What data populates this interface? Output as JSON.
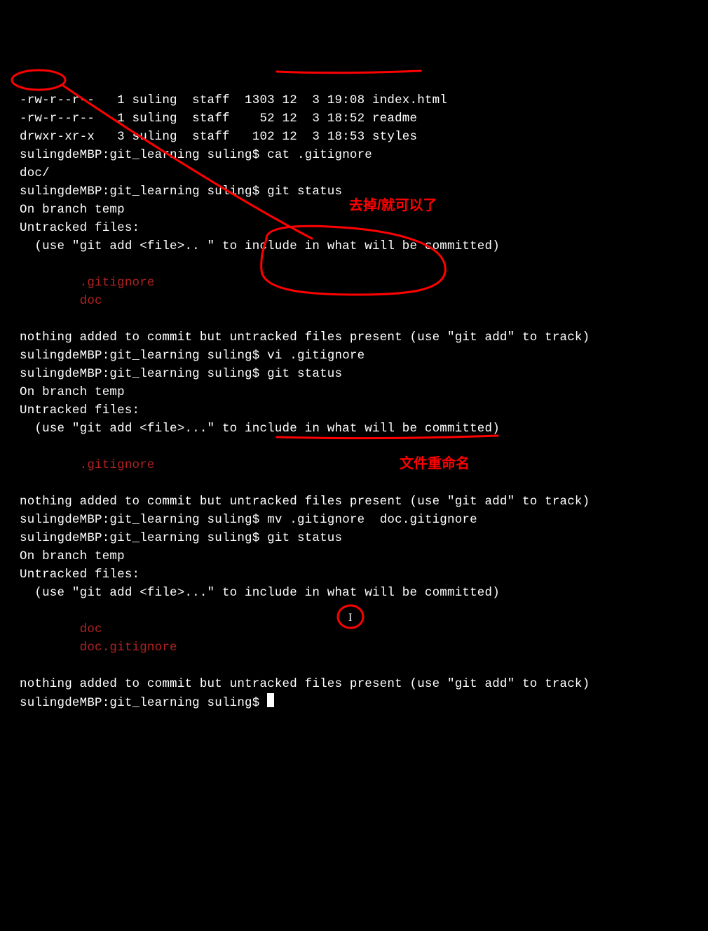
{
  "terminal": {
    "ls": {
      "l1": "-rw-r--r--   1 suling  staff  1303 12  3 19:08 index.html",
      "l2": "-rw-r--r--   1 suling  staff    52 12  3 18:52 readme",
      "l3": "drwxr-xr-x   3 suling  staff   102 12  3 18:53 styles"
    },
    "prompt": "sulingdeMBP:git_learning suling$ ",
    "cmd_cat": "cat .gitignore",
    "cat_out": "doc/",
    "cmd_status1": "git status",
    "status_branch": "On branch temp",
    "status_untracked_hdr": "Untracked files:",
    "status_hint_a": "  (use \"git add <file>.. \" to include in what will be committed)",
    "status_hint_b": "  (use \"git add <file>...\" to include in what will be committed)",
    "untracked_gitignore": "        .gitignore",
    "untracked_doc": "        doc",
    "nothing_added": "nothing added to commit but untracked files present (use \"git add\" to track)",
    "cmd_vi": "vi .gitignore",
    "cmd_status2": "git status",
    "cmd_mv": "mv .gitignore  doc.gitignore",
    "cmd_status3": "git status",
    "untracked_doc2": "        doc",
    "untracked_docgitignore": "        doc.gitignore"
  },
  "annotations": {
    "remove_slash": "去掉/就可以了",
    "rename_file": "文件重命名"
  }
}
